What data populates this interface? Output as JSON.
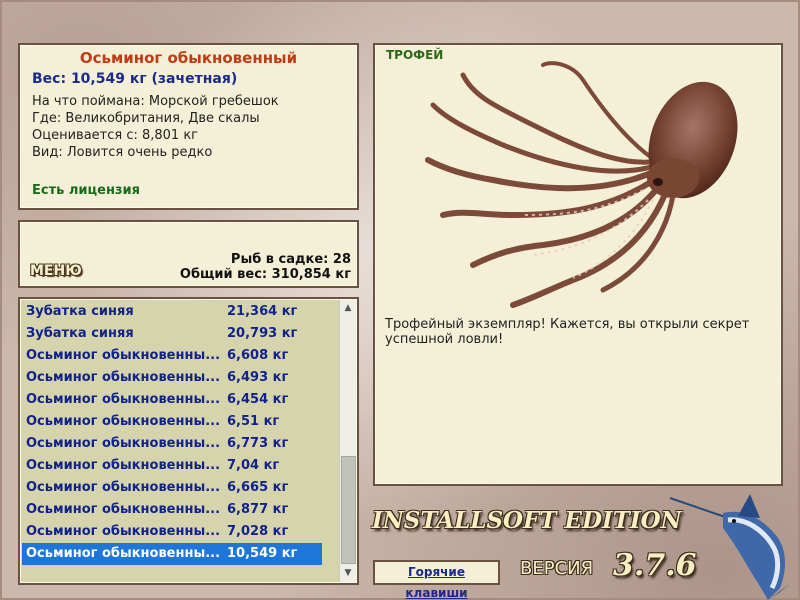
{
  "info": {
    "fish_name": "Осьминог обыкновенный",
    "weight_line": "Вес: 10,549 кг (зачетная)",
    "bait_line": "На что поймана: Морской гребешок",
    "place_line": "Где: Великобритания, Две скалы",
    "valued_line": "Оценивается с: 8,801 кг",
    "type_line": "Вид: Ловится очень редко",
    "license": "Есть лицензия"
  },
  "stats": {
    "menu_label": "МЕНЮ",
    "fish_count": "Рыб в садке: 28",
    "total_weight": "Общий вес: 310,854 кг"
  },
  "catch_list": [
    {
      "name": "Зубатка синяя",
      "weight": "21,364 кг"
    },
    {
      "name": "Зубатка синяя",
      "weight": "20,793 кг"
    },
    {
      "name": "Осьминог обыкновенны...",
      "weight": "6,608 кг"
    },
    {
      "name": "Осьминог обыкновенны...",
      "weight": "6,493 кг"
    },
    {
      "name": "Осьминог обыкновенны...",
      "weight": "6,454 кг"
    },
    {
      "name": "Осьминог обыкновенны...",
      "weight": "6,51 кг"
    },
    {
      "name": "Осьминог обыкновенны...",
      "weight": "6,773 кг"
    },
    {
      "name": "Осьминог обыкновенны...",
      "weight": "7,04 кг"
    },
    {
      "name": "Осьминог обыкновенны...",
      "weight": "6,665 кг"
    },
    {
      "name": "Осьминог обыкновенны...",
      "weight": "6,877 кг"
    },
    {
      "name": "Осьминог обыкновенны...",
      "weight": "7,028 кг"
    },
    {
      "name": "Осьминог обыкновенны...",
      "weight": "10,549 кг",
      "selected": true
    }
  ],
  "trophy": {
    "label": "ТРОФЕЙ",
    "message": "Трофейный экземпляр! Кажется, вы открыли секрет успешной ловли!",
    "image": "octopus-image"
  },
  "footer": {
    "hotkeys": "Горячие клавиши",
    "brand": "INSTALLSOFT EDITION",
    "version_label": "ВЕРСИЯ",
    "version_number": "3.7.6",
    "logo": "marlin-logo"
  },
  "colors": {
    "panel_bg": "#f4f0d8",
    "list_bg": "#d6d4ad",
    "selected_row": "#1e76d8",
    "list_text": "#11238a",
    "title": "#c03a12",
    "license": "#1b6a1b",
    "trophy_label": "#2d6a18"
  }
}
